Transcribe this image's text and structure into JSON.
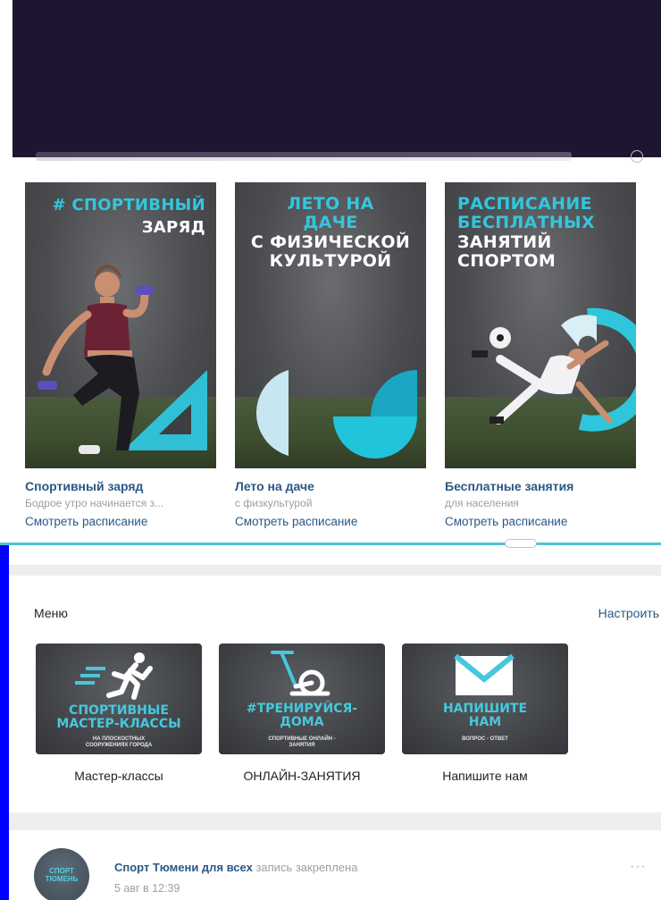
{
  "cards": [
    {
      "headline_cyan": "# СПОРТИВНЫЙ",
      "headline_white": "ЗАРЯД",
      "title": "Спортивный заряд",
      "subtitle": "Бодрое утро начинается з...",
      "link": "Смотреть расписание"
    },
    {
      "headline_cyan": "ЛЕТО НА ДАЧЕ",
      "headline_white": "С ФИЗИЧЕСКОЙ КУЛЬТУРОЙ",
      "title": "Лето на даче",
      "subtitle": "с физкультурой",
      "link": "Смотреть расписание"
    },
    {
      "headline_cyan": "РАСПИСАНИЕ БЕСПЛАТНЫХ",
      "headline_white": "ЗАНЯТИЙ СПОРТОМ",
      "title": "Бесплатные занятия",
      "subtitle": "для населения",
      "link": "Смотреть расписание"
    }
  ],
  "menu": {
    "title": "Меню",
    "configure": "Настроить",
    "tiles": [
      {
        "art_title": "СПОРТИВНЫЕ МАСТЕР-КЛАССЫ",
        "art_small": "НА ПЛОСКОСТНЫХ СООРУЖЕНИЯХ ГОРОДА",
        "label": "Мастер-классы",
        "icon": "runner-icon"
      },
      {
        "art_title": "#ТРЕНИРУЙСЯ-ДОМА",
        "art_small": "СПОРТИВНЫЕ ОНЛАЙН - ЗАНЯТИЯ",
        "label": "ОНЛАЙН-ЗАНЯТИЯ",
        "icon": "exercise-bike-icon"
      },
      {
        "art_title": "НАПИШИТЕ НАМ",
        "art_small": "ВОПРОС - ОТВЕТ",
        "label": "Напишите нам",
        "icon": "envelope-icon"
      }
    ]
  },
  "post": {
    "author": "Спорт Тюмени для всех",
    "note": "запись закреплена",
    "date": "5 авг в 12:39",
    "more": "···",
    "avatar_text": "СПОРТ ТЮМЕНЬ"
  },
  "colors": {
    "accent": "#33c6dd",
    "link": "#2a5885",
    "header_band": "#1e1533"
  }
}
